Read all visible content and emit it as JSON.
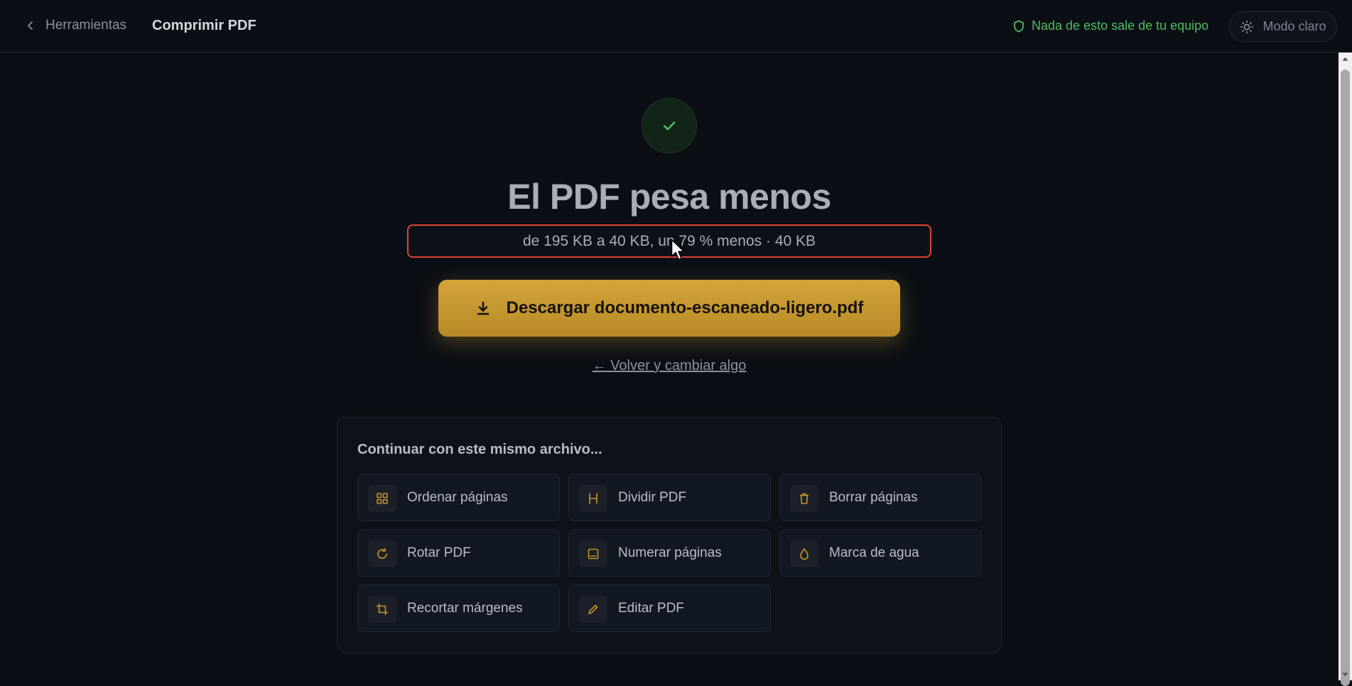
{
  "header": {
    "back_label": "Herramientas",
    "page_title": "Comprimir PDF",
    "privacy_note": "Nada de esto sale de tu equipo",
    "theme_label": "Modo claro"
  },
  "result": {
    "title": "El PDF pesa menos",
    "summary": "de 195 KB a 40 KB, un 79 % menos · 40 KB",
    "download_label": "Descargar documento-escaneado-ligero.pdf",
    "back_change_label": "← Volver y cambiar algo"
  },
  "continue_panel": {
    "title": "Continuar con este mismo archivo...",
    "tools": [
      {
        "label": "Ordenar páginas",
        "icon": "grid-icon"
      },
      {
        "label": "Dividir PDF",
        "icon": "split-icon"
      },
      {
        "label": "Borrar páginas",
        "icon": "trash-icon"
      },
      {
        "label": "Rotar PDF",
        "icon": "rotate-icon"
      },
      {
        "label": "Numerar páginas",
        "icon": "page-number-icon"
      },
      {
        "label": "Marca de agua",
        "icon": "droplet-icon"
      },
      {
        "label": "Recortar márgenes",
        "icon": "crop-icon"
      },
      {
        "label": "Editar PDF",
        "icon": "pencil-icon"
      }
    ]
  },
  "colors": {
    "background": "#0b0f15",
    "accent": "#c9962a",
    "success": "#4cbb5d",
    "highlight_border": "#e0433a"
  }
}
